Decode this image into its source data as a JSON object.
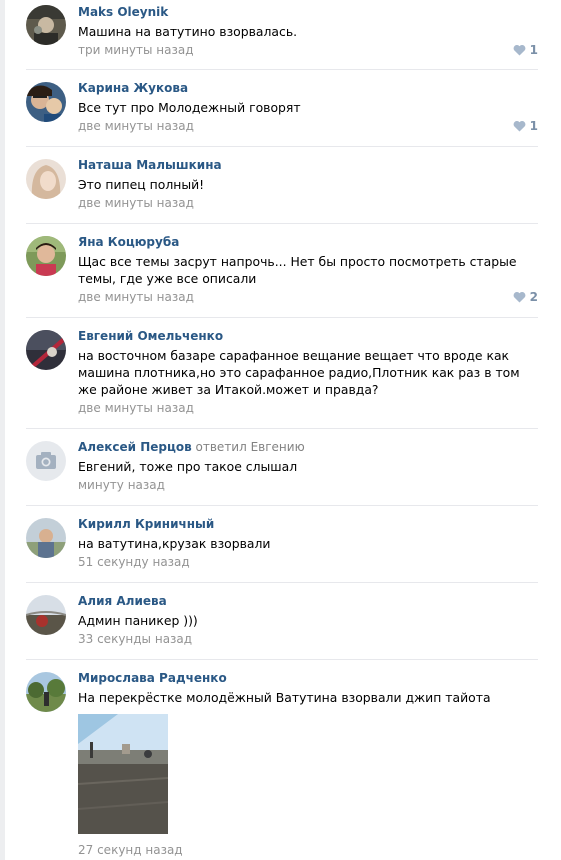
{
  "colors": {
    "author_link": "#2a5885",
    "meta_text": "#939393",
    "like_color": "#7b90a8",
    "divider": "#e7e8ec"
  },
  "comments": [
    {
      "author": "Maks Oleynik",
      "text": "Машина на ватутино взорвалась.",
      "date": "три минуты назад",
      "likes": "1",
      "avatar": "user-photo"
    },
    {
      "author": "Карина Жукова",
      "text": "Все тут про Молодежный говорят",
      "date": "две минуты назад",
      "likes": "1",
      "avatar": "user-photo"
    },
    {
      "author": "Наташа Малышкина",
      "text": "Это пипец полный!",
      "date": "две минуты назад",
      "avatar": "user-photo"
    },
    {
      "author": "Яна Коцюруба",
      "text": "Щас все темы засрут напрочь... Нет бы просто посмотреть старые темы, где уже все описали",
      "date": "две минуты назад",
      "likes": "2",
      "avatar": "user-photo"
    },
    {
      "author": "Евгений Омельченко",
      "text": "на восточном базаре сарафанное вещание вещает что вроде как машина плотника,но это сарафанное радио,Плотник как раз в том же районе живет за Итакой.может и правда?",
      "date": "две минуты назад",
      "avatar": "user-photo"
    },
    {
      "author": "Алексей Перцов",
      "reply_to": "ответил Евгению",
      "text": "Евгений, тоже про такое слышал",
      "date": "минуту назад",
      "avatar": "camera-placeholder-icon"
    },
    {
      "author": "Кирилл Криничный",
      "text": "на ватутина,крузак взорвали",
      "date": "51 секунду назад",
      "avatar": "user-photo"
    },
    {
      "author": "Алия Алиева",
      "text": "Админ паникер )))",
      "date": "33 секунды назад",
      "avatar": "user-photo"
    },
    {
      "author": "Мирослава Радченко",
      "text": "На перекрёстке молодёжный Ватутина взорвали джип тайота",
      "date": "27 секунд назад",
      "avatar": "user-photo",
      "attachment": "street-photo"
    }
  ]
}
